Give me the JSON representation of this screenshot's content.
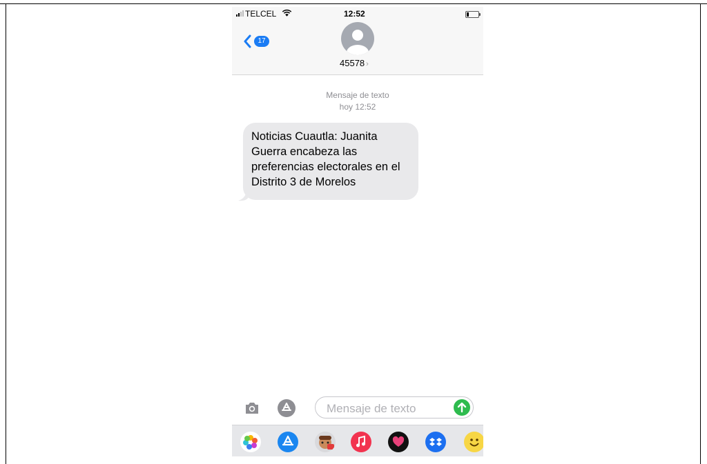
{
  "status_bar": {
    "carrier": "TELCEL",
    "time": "12:52"
  },
  "header": {
    "back_count": "17",
    "contact": "45578"
  },
  "conversation": {
    "label": "Mensaje de texto",
    "timestamp": "hoy 12:52",
    "messages": [
      {
        "text": "Noticias Cuautla: Juanita Guerra encabeza las preferencias electorales en el Distrito 3 de Morelos"
      }
    ]
  },
  "composer": {
    "placeholder": "Mensaje de texto"
  },
  "app_drawer": [
    "photos-icon",
    "app-store-icon",
    "memoji-icon",
    "music-icon",
    "heart-app-icon",
    "dropbox-icon",
    "emoji-icon"
  ],
  "colors": {
    "ios_blue": "#1a7cf4",
    "bubble_gray": "#e9e9eb",
    "send_green": "#2ebb4e",
    "meta_gray": "#8e8e93"
  }
}
